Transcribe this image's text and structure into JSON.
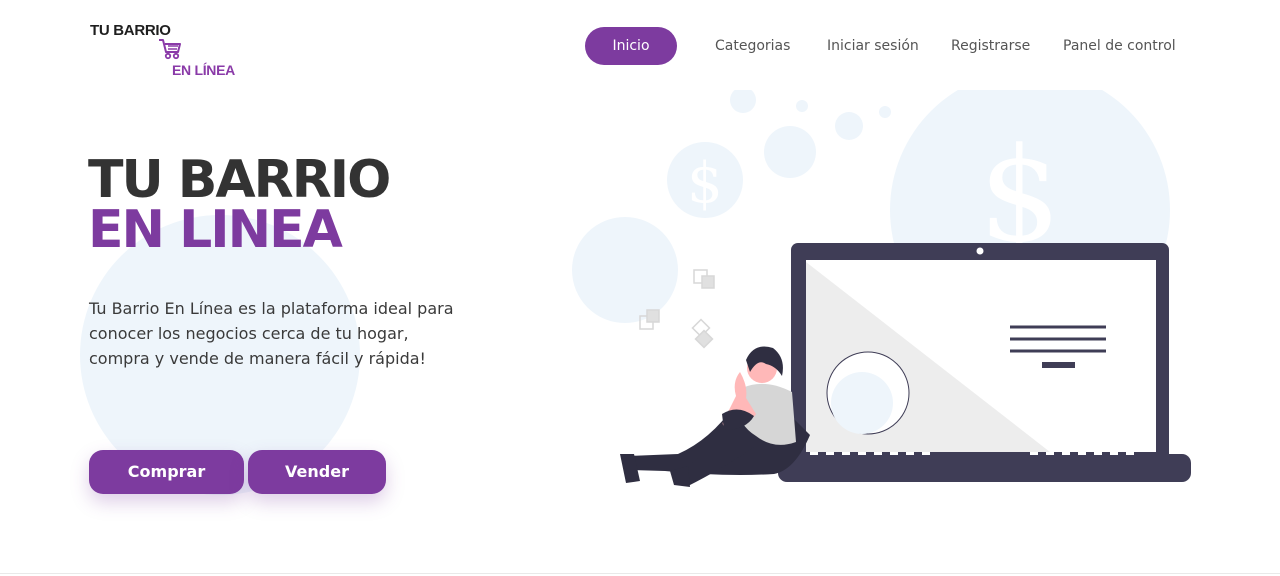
{
  "logo": {
    "line1": "TU BARRIO",
    "line2": "EN LÍNEA",
    "icon": "shopping-cart-icon"
  },
  "nav": {
    "items": [
      {
        "label": "Inicio",
        "active": true
      },
      {
        "label": "Categorias",
        "active": false
      },
      {
        "label": "Iniciar sesión",
        "active": false
      },
      {
        "label": "Registrarse",
        "active": false
      },
      {
        "label": "Panel de control",
        "active": false
      }
    ]
  },
  "hero": {
    "title_line1": "TU BARRIO",
    "title_line2": "EN LINEA",
    "description": "Tu Barrio En Línea es la plataforma ideal para conocer los negocios cerca de tu hogar, compra y vende de manera fácil y rápida!",
    "buy_label": "Comprar",
    "sell_label": "Vender"
  },
  "colors": {
    "accent": "#7d3b9f",
    "title_dark": "#333333",
    "illustration_dark": "#3f3d56"
  }
}
